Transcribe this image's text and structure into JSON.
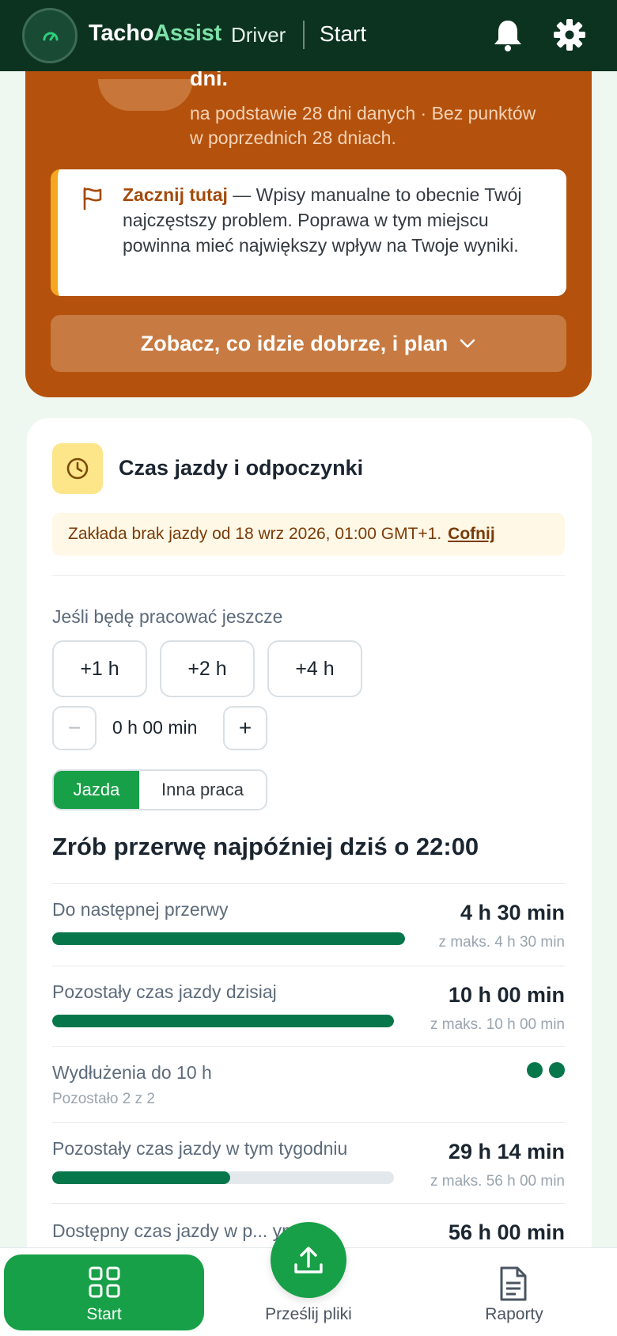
{
  "appbar": {
    "brand_part1": "Tacho",
    "brand_part2": "Assist",
    "role": "Driver",
    "screen_title": "Start"
  },
  "summary": {
    "headline_tail": "dni.",
    "subtext": "na podstawie 28 dni danych · Bez punktów w poprzednich 28 dniach.",
    "callout_strong": "Zacznij tutaj",
    "callout_text": " — Wpisy manualne to obecnie Twój najczęstszy problem. Poprawa w tym miejscu powinna mieć największy wpływ na Twoje wyniki.",
    "plan_button": "Zobacz, co idzie dobrze, i plan"
  },
  "drive": {
    "title": "Czas jazdy i odpoczynki",
    "assumption": "Zakłada brak jazdy od 18 wrz 2026, 01:00 GMT+1.",
    "undo": "Cofnij",
    "if_work_label": "Jeśli będę pracować jeszcze",
    "chips": [
      "+1 h",
      "+2 h",
      "+4 h"
    ],
    "stepper_minus": "−",
    "stepper_value": "0 h 00 min",
    "stepper_plus": "+",
    "segment": [
      "Jazda",
      "Inna praca"
    ],
    "headline": "Zrób przerwę najpóźniej dziś o 22:00",
    "rows": [
      {
        "label": "Do następnej przerwy",
        "value": "4 h 30 min",
        "max": "z maks. 4 h 30 min",
        "progress": 1.0
      },
      {
        "label": "Pozostały czas jazdy dzisiaj",
        "value": "10 h 00 min",
        "max": "z maks. 10 h 00 min",
        "progress": 1.0
      },
      {
        "label": "Wydłużenia do 10 h",
        "sub": "Pozostało 2 z 2",
        "dots": 2
      },
      {
        "label": "Pozostały czas jazdy w tym tygodniu",
        "value": "29 h 14 min",
        "max": "z maks. 56 h 00 min",
        "progress": 0.52
      },
      {
        "label": "Dostępny czas jazdy w p... ym",
        "value": "56 h 00 min"
      }
    ]
  },
  "nav": {
    "start": "Start",
    "upload": "Prześlij pliki",
    "reports": "Raporty"
  },
  "colors": {
    "appbar": "#0c3220",
    "summary": "#b4520d",
    "accent_green": "#17a047",
    "progress": "#07774b"
  },
  "icons": [
    "gauge-icon",
    "bell-icon",
    "gear-icon",
    "flag-icon",
    "chevron-down-icon",
    "clock-icon",
    "grid-icon",
    "upload-icon",
    "document-icon"
  ]
}
